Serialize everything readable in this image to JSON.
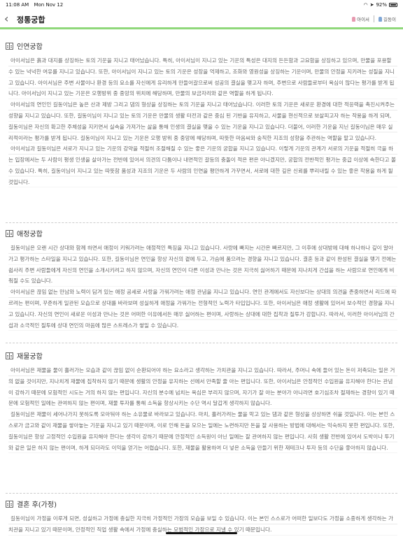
{
  "status": {
    "time": "11:08 AM",
    "date": "Mon Nov 12",
    "battery": "92%"
  },
  "nav": {
    "title": "정통궁합",
    "person1": "아이서",
    "person2": "길동이"
  },
  "sections": [
    {
      "title": "인연궁합",
      "paragraphs": [
        "아이서님은 흙과 대지를 상징하는 토의 기운을 지니고 태어났습니다. 특히, 아이서님이 지니고 있는 기운의 특성은 대지의 든든함과 고요함을 상징하고 있으며, 만물을 포용할 수 있는 넉넉한 여유를 지니고 있습니다. 또한, 아이서님이 지니고 있는 토의 기운은 성장을 억제하고, 조화와 영원성을 상징하는 기운이며, 만물의 안정을 지키려는 성질을 지니고 있습니다. 아이서님은 주변 사물이나 환경 등의 요소를 자신에게 유리하게 만들어갈으로써 성공의 결실을 맺고자 하며, 주변으로 사람들로부터 욕심이 많다는 평가를 받게 됩니다. 아이서님이 지니고 있는 기운은 오행방위 중 중앙의 위치에 해당하며, 만물의 보금자리와 같은 역할을 하게 됩니다.",
        "아이서님의 연인인 길동이님은 높은 산과 제방 그리고 댐의 형상을 상징하는 토의 기운을 지니고 태어났습니다. 이러한 토의 기운은 새로운 환경에 대한 적응력을 촉진시켜주는 성향을 지니고 있습니다. 또한, 길동이님이 지니고 있는 토의 기운은 만물의 생활 터전과 같은 중심 된 기반을 유지하고, 사물을 현신적으로 보살피고자 하는 작용을 하게 되며, 길동이님은 자신의 확고한 주체성을 지키면서 실속을 가져가는 삶을 통해 인생의 결실을 맺을 수 있는 기운을 지니고 있습니다. 더불어, 이러한 기운을 지닌 길동이님은 매우 실리적이라는 평가를 받게 됩니다. 길동이님이 지니고 있는 기운은 오행 방위 중 중앙에 해당하며, 따뜻한 마음씨와 숭직한 지조의 성향을 주관하는 역할을 맡고 있습니다.",
        "아이서님과 길동이님은 서로가 지니고 있는 기운의 강약을 적절히 조절해질 수 있는 좋은 기운의 궁합을 지니고 있습니다. 이렇게 기운의 관계가 서로의 기운을 적절히 극을 하는 입장에서는 두 사람이 평생 인생을 살아가는 전반에 있어서 의견의 다툼이나 내면적인 갈등의 충돌이 적은 편은 아니겠지만, 궁합의 전반적인 평가는 중급 이상에 속한다고 볼 수 있습니다. 특히, 길동이님이 지니고 있는 따뜻함 품성과 지조의 기운은 두 사람의 인연을 평안하게 가꾸면서, 서로에 대한 깊은 신뢰를 뿌리내릴 수 있는 좋은 작용을 하게 될 것입니다."
      ]
    },
    {
      "title": "애정궁합",
      "paragraphs": [
        "길동이님은 오랜 시간 상대와 함께 하면서 애정이 키워가려는 애정적인 특징을 지니고 있습니다. 사랑에 빠지는 시간은 빠르지만, 그 이후에 상대방에 대해 하나하나 깊이 알아가고 평가하는 스타일을 지니고 있습니다. 또한, 길동이님은 연인을 항상 자신의 곁에 두고, 가슴에 품으려는 경향을 지니고 있습니다. 결혼 등과 같이 완성된 결실을 맺기 전에는 쉽사리 주변 사람들에게 자신의 연인을 소개시키려고 하지 않으며, 자신의 연인이 다른 이성과 만나는 것은 지극히 싫어하기 때문에 지나치게 간섭을 하는 사람으로 연인에게 비춰질 수도 있습니다.",
        "아이서님은 끊임 없는 만남와 노력이 담겨 있는 애정 공세로 사랑을 가꿔가려는 애정 관념을 지니고 있습니다. 연인 관계에서도 자신보다는 상대의 의견을 존중하면서 리드에 따르려는 편이며, 꾸준하게 일관된 모습으로 상대를 바라보며 성실하게 애정을 가꿔가는 전형적인 노력가 타입입니다. 또한, 아이서님은 애정 생활에 있어서 보수적인 경향을 지니고 있습니다. 자신의 연인이 새로운 이성과 만나는 것은 어떠한 이유에서든 매우 싫어하는 편이며, 사랑하는 상대에 대한 집착과 질투가 강합니다. 따라서, 이러한 아이서님의 간섭과 소극적인 질투에 상대 연인의 마음에 많은 스트레스가 쌓일 수 있습니다."
      ]
    },
    {
      "title": "재물궁합",
      "paragraphs": [
        "아이서님은 재물을 물이 흘러가는 모습과 같이 끊임 없이 순환되어야 하는 요소라고 생각하는 가치관을 지니고 있습니다. 따라서, 주머니 속에 들어 있는 돈이 저축되는 일은 거의 없을 것이지만, 지나치게 재물에 집착하지 않기 때문에 생활의 안정을 유지하는 선에서 만족할 줄 아는 편입니다. 또한, 아이서님은 안정적인 수입원을 유지해야 한다는 관념이 강하기 때문에 모험적인 시도는 거의 하지 않는 편입니다. 자신의 분수에 넘치는 욕심은 부리지 않으며, 자기가 잘 아는 분야가 아니라면 호기심조차 절제하는 경향이 있기 때문에 모험적인 일에는 관여하지 않는 편이며, 재물 투자를 통해 소득을 항상시키는 수단 역시 달갑게 생각하지 않습니다.",
        "길동이님은 재물이 세어나가지 못하도록 모아둬야 하는 소유물로 바라보고 있습니다. 마치, 흘러가려는 물을 막고 있는 댐과 같은 형상을 상상하면 쉬울 것입니다. 이는 본인 스스로가 금고와 같이 재물을 쌓아놓는 기운을 지니고 있기 때문이며, 이로 인해 돈을 모으는 일에는 노련하지만 돈을 잘 사용하는 방법에 대해서는 익숙하지 못한 편입니다. 또한, 길동이님은 항상 고정적인 수입원을 유지해야 한다는 생각이 강하기 때문에 안정적인 소득원이 아닌 일에는 잘 관여하지 않는 편입니다. 사회 생활 전반에 있어서 도박이나 투기와 같은 일은 하지 않는 편이며, 하게 되더라도 이익을 얻기는 어렵습니다. 또한, 재물을 활용하여 더 넣은 소득을 만들기 위한 재테크나 투자 등의 수단을 좋아하지 않습니다."
      ]
    },
    {
      "title": "결혼 후(가정)",
      "paragraphs": [
        "길동이님이 가정을 이루게 되면, 성실하고 가정에 충실한 지극히 가정적인 가장의 모습을 보일 수 있습니다. 이는 본인 스스로가 어떠한 일보다도 가정을 소중하게 생각하는 가치관을 지니고 있기 때문이며, 안정적인 직업 생활 속에서 가정에 충실하는 모범적인 가장으로 지낼 수 있기 때문입니다."
      ]
    }
  ]
}
